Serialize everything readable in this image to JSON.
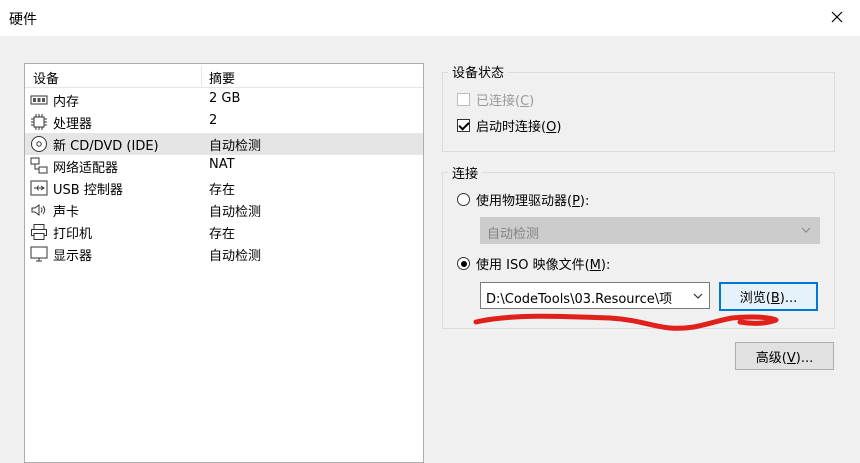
{
  "window": {
    "title": "硬件"
  },
  "device_list": {
    "headers": {
      "device": "设备",
      "summary": "摘要"
    },
    "rows": [
      {
        "icon": "memory-icon",
        "name": "内存",
        "summary": "2 GB",
        "selected": false
      },
      {
        "icon": "processor-icon",
        "name": "处理器",
        "summary": "2",
        "selected": false
      },
      {
        "icon": "cd-dvd-icon",
        "name": "新 CD/DVD (IDE)",
        "summary": "自动检测",
        "selected": true
      },
      {
        "icon": "network-adapter-icon",
        "name": "网络适配器",
        "summary": "NAT",
        "selected": false
      },
      {
        "icon": "usb-icon",
        "name": "USB 控制器",
        "summary": "存在",
        "selected": false
      },
      {
        "icon": "sound-card-icon",
        "name": "声卡",
        "summary": "自动检测",
        "selected": false
      },
      {
        "icon": "printer-icon",
        "name": "打印机",
        "summary": "存在",
        "selected": false
      },
      {
        "icon": "display-icon",
        "name": "显示器",
        "summary": "自动检测",
        "selected": false
      }
    ]
  },
  "device_status": {
    "label": "设备状态",
    "connected": {
      "text": "已连接(",
      "mnemonic": "C",
      "suffix": ")",
      "checked": false,
      "enabled": false
    },
    "connect_at_power_on": {
      "text": "启动时连接(",
      "mnemonic": "O",
      "suffix": ")",
      "checked": true,
      "enabled": true
    }
  },
  "connection": {
    "label": "连接",
    "use_physical_drive": {
      "text": "使用物理驱动器(",
      "mnemonic": "P",
      "suffix": "):",
      "selected": false
    },
    "physical_drive_value": "自动检测",
    "use_iso_image": {
      "text": "使用 ISO 映像文件(",
      "mnemonic": "M",
      "suffix": "):",
      "selected": true
    },
    "iso_path_value": "D:\\CodeTools\\03.Resource\\项",
    "browse_button": {
      "text": "浏览(",
      "mnemonic": "B",
      "suffix": ")..."
    }
  },
  "advanced_button": {
    "text": "高级(",
    "mnemonic": "V",
    "suffix": ")..."
  },
  "colors": {
    "window_bg": "#f0f0f0",
    "selection_bg": "#e5e5e5",
    "focus_border": "#0078d7",
    "annotation_red": "#e0201b"
  }
}
